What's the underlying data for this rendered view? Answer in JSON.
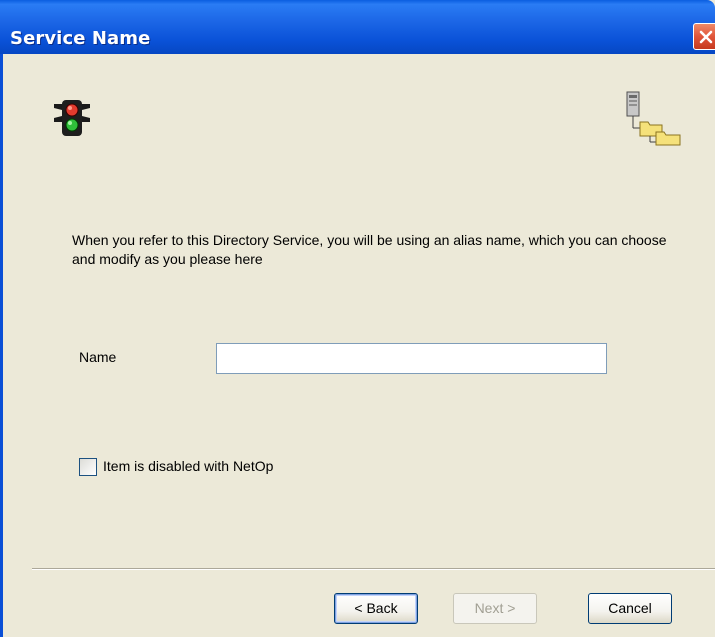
{
  "window": {
    "title": "Service Name"
  },
  "icons": {
    "close": "close-icon",
    "traffic_light": "traffic-light-icon",
    "directory_tree": "directory-tree-icon"
  },
  "main": {
    "intro_text": "When you refer to this Directory Service, you will be using an alias name, which you can choose and modify as you please here",
    "name_label": "Name",
    "name_value": "",
    "checkbox_label": "Item is disabled with NetOp",
    "checkbox_checked": false
  },
  "buttons": {
    "back_label": "< Back",
    "next_label": "Next >",
    "cancel_label": "Cancel"
  }
}
